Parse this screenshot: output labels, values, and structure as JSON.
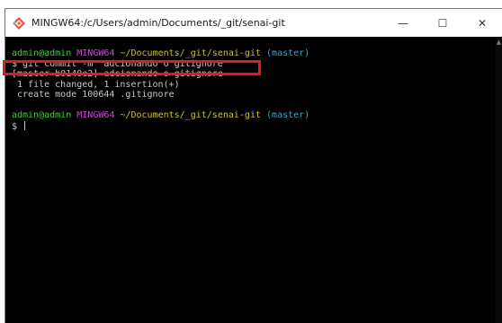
{
  "window": {
    "title": "MINGW64:/c/Users/admin/Documents/_git/senai-git",
    "minimize_glyph": "—",
    "maximize_glyph": "☐",
    "close_glyph": "✕"
  },
  "terminal": {
    "prompt1": {
      "user": "admin@admin",
      "host": "MINGW64",
      "path": "~/Documents/_git/senai-git",
      "branch": "(master)"
    },
    "command": "$ git commit -m \"adcionando o gitignore\"",
    "output": [
      "[master b0140e2] adcionando o gitignore",
      " 1 file changed, 1 insertion(+)",
      " create mode 100644 .gitignore"
    ],
    "prompt2": {
      "user": "admin@admin",
      "host": "MINGW64",
      "path": "~/Documents/_git/senai-git",
      "branch": "(master)"
    },
    "current_input": "$ "
  },
  "colors": {
    "user": "#3ecf3e",
    "host": "#c44ecc",
    "path": "#c9c23a",
    "branch": "#3aa9c9",
    "highlight": "#e31b1b"
  },
  "icons": {
    "app": "git-bash-icon"
  }
}
